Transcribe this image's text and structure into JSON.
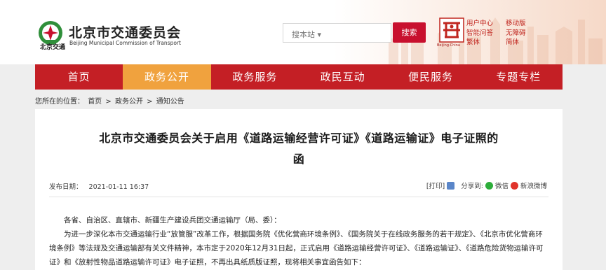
{
  "header": {
    "logo_small": "北京交通",
    "site_title": "北京市交通委员会",
    "site_subtitle": "Beijing Municipal Commission of Transport",
    "search_scope": "搜本站 ▾",
    "search_button": "搜索",
    "city_emblem_caption": "Beijing·China",
    "links_col1": [
      "用户中心",
      "智能问答",
      "繁体"
    ],
    "links_col2": [
      "移动版",
      "无障碍",
      "简体"
    ]
  },
  "nav": {
    "items": [
      "首页",
      "政务公开",
      "政务服务",
      "政民互动",
      "便民服务",
      "专题专栏"
    ],
    "active_index": 1
  },
  "breadcrumb": {
    "prefix": "您所在的位置：",
    "items": [
      "首页",
      "政务公开",
      "通知公告"
    ],
    "separator": ">"
  },
  "article": {
    "title_line1": "北京市交通委员会关于启用《道路运输经营许可证》《道路运输证》电子证照的",
    "title_line2": "函",
    "date_label": "发布日期：",
    "date_value": "2021-01-11 16:37",
    "print_label": "[打印]",
    "share_label": "分享到:",
    "share_wechat": "微信",
    "share_weibo": "新浪微博",
    "salutation": "各省、自治区、直辖市、新疆生产建设兵团交通运输厅（局、委）：",
    "para_line1": "为进一步深化本市交通运输行业“放管服”改革工作，根据国务院《优化营商环境条例》、《国务院关于在线政务服务的若干规定》、《北京市优化营商环",
    "para_line2": "境条例》等法规及交通运输部有关文件精神，本市定于2020年12月31日起，正式启用《道路运输经营许可证》、《道路运输证》、《道路危险货物运输许可",
    "para_line3": "证》和《放射性物品道路运输许可证》电子证照，不再出具纸质版证照，现将相关事宜函告如下："
  },
  "colors": {
    "nav_red": "#c41f25",
    "nav_active": "#f0a23e",
    "search_red": "#c8102e",
    "link_red": "#c0261f"
  }
}
